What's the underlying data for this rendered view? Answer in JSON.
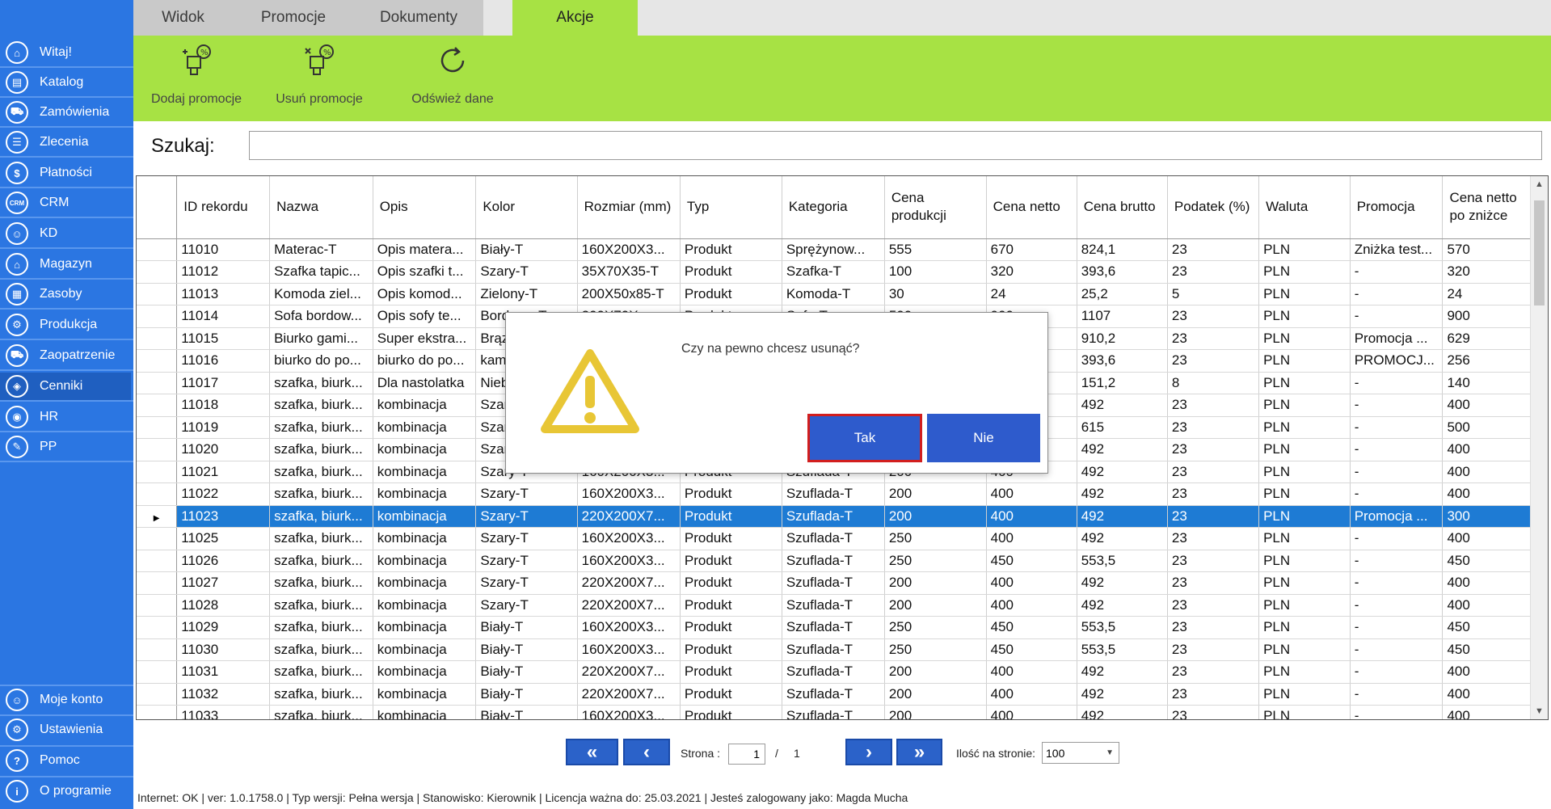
{
  "sidebar": {
    "top_items": [
      {
        "label": "Witaj!",
        "icon": "home-icon",
        "glyph": "⌂"
      },
      {
        "label": "Katalog",
        "icon": "book-icon",
        "glyph": "▤"
      },
      {
        "label": "Zamówienia",
        "icon": "cart-icon",
        "glyph": "⛟"
      },
      {
        "label": "Zlecenia",
        "icon": "list-icon",
        "glyph": "☰"
      },
      {
        "label": "Płatności",
        "icon": "dollar-icon",
        "glyph": "$"
      },
      {
        "label": "CRM",
        "icon": "crm-icon",
        "glyph": "CRM"
      },
      {
        "label": "KD",
        "icon": "user-icon",
        "glyph": "☺"
      },
      {
        "label": "Magazyn",
        "icon": "warehouse-icon",
        "glyph": "⌂"
      },
      {
        "label": "Zasoby",
        "icon": "resources-icon",
        "glyph": "▦"
      },
      {
        "label": "Produkcja",
        "icon": "production-icon",
        "glyph": "⚙"
      },
      {
        "label": "Zaopatrzenie",
        "icon": "supply-icon",
        "glyph": "⛟"
      },
      {
        "label": "Cenniki",
        "icon": "tag-icon",
        "glyph": "◈"
      },
      {
        "label": "HR",
        "icon": "hr-icon",
        "glyph": "◉"
      },
      {
        "label": "PP",
        "icon": "pp-icon",
        "glyph": "✎"
      }
    ],
    "active_index": 11,
    "bottom_items": [
      {
        "label": "Moje konto",
        "icon": "account-icon",
        "glyph": "☺"
      },
      {
        "label": "Ustawienia",
        "icon": "settings-icon",
        "glyph": "⚙"
      },
      {
        "label": "Pomoc",
        "icon": "help-icon",
        "glyph": "?"
      },
      {
        "label": "O programie",
        "icon": "info-icon",
        "glyph": "i"
      }
    ]
  },
  "tabs": [
    "Widok",
    "Promocje",
    "Dokumenty",
    "Akcje"
  ],
  "active_tab": "Akcje",
  "toolbar": {
    "add": "Dodaj promocje",
    "remove": "Usuń promocje",
    "refresh": "Odśwież dane"
  },
  "search": {
    "label": "Szukaj:",
    "value": "",
    "placeholder": ""
  },
  "table": {
    "columns": [
      "ID rekordu",
      "Nazwa",
      "Opis",
      "Kolor",
      "Rozmiar (mm)",
      "Typ",
      "Kategoria",
      "Cena produkcji",
      "Cena netto",
      "Cena brutto",
      "Podatek (%)",
      "Waluta",
      "Promocja",
      "Cena netto po zniżce"
    ],
    "selected_row": 12,
    "rows": [
      [
        "11010",
        "Materac-T",
        "Opis matera...",
        "Biały-T",
        "160X200X3...",
        "Produkt",
        "Sprężynow...",
        "555",
        "670",
        "824,1",
        "23",
        "PLN",
        "Zniżka test...",
        "570"
      ],
      [
        "11012",
        "Szafka tapic...",
        "Opis szafki t...",
        "Szary-T",
        "35X70X35-T",
        "Produkt",
        "Szafka-T",
        "100",
        "320",
        "393,6",
        "23",
        "PLN",
        "-",
        "320"
      ],
      [
        "11013",
        "Komoda ziel...",
        "Opis komod...",
        "Zielony-T",
        "200X50x85-T",
        "Produkt",
        "Komoda-T",
        "30",
        "24",
        "25,2",
        "5",
        "PLN",
        "-",
        "24"
      ],
      [
        "11014",
        "Sofa bordow...",
        "Opis sofy te...",
        "Bordowy-T",
        "200X70X...",
        "Produkt",
        "Sofa-T",
        "500",
        "900",
        "1107",
        "23",
        "PLN",
        "-",
        "900"
      ],
      [
        "11015",
        "Biurko gami...",
        "Super ekstra...",
        "Brązowy-T",
        "...",
        "Produkt",
        "...",
        "...",
        "...",
        "910,2",
        "23",
        "PLN",
        "Promocja ...",
        "629"
      ],
      [
        "11016",
        "biurko do po...",
        "biurko do po...",
        "kamień",
        "...",
        "Produkt",
        "...",
        "...",
        "...",
        "393,6",
        "23",
        "PLN",
        "PROMOCJ...",
        "256"
      ],
      [
        "11017",
        "szafka, biurk...",
        "Dla nastolatka",
        "Niebieski",
        "...",
        "Produkt",
        "...",
        "...",
        "...",
        "151,2",
        "8",
        "PLN",
        "-",
        "140"
      ],
      [
        "11018",
        "szafka, biurk...",
        "kombinacja",
        "Szary-T",
        "...",
        "Produkt",
        "...",
        "...",
        "...",
        "492",
        "23",
        "PLN",
        "-",
        "400"
      ],
      [
        "11019",
        "szafka, biurk...",
        "kombinacja",
        "Szary-T",
        "...",
        "Produkt",
        "...",
        "...",
        "...",
        "615",
        "23",
        "PLN",
        "-",
        "500"
      ],
      [
        "11020",
        "szafka, biurk...",
        "kombinacja",
        "Szary-T",
        "...",
        "Produkt",
        "...",
        "...",
        "...",
        "492",
        "23",
        "PLN",
        "-",
        "400"
      ],
      [
        "11021",
        "szafka, biurk...",
        "kombinacja",
        "Szary-T",
        "160X200X3...",
        "Produkt",
        "Szuflada-T",
        "200",
        "400",
        "492",
        "23",
        "PLN",
        "-",
        "400"
      ],
      [
        "11022",
        "szafka, biurk...",
        "kombinacja",
        "Szary-T",
        "160X200X3...",
        "Produkt",
        "Szuflada-T",
        "200",
        "400",
        "492",
        "23",
        "PLN",
        "-",
        "400"
      ],
      [
        "11023",
        "szafka, biurk...",
        "kombinacja",
        "Szary-T",
        "220X200X7...",
        "Produkt",
        "Szuflada-T",
        "200",
        "400",
        "492",
        "23",
        "PLN",
        "Promocja ...",
        "300"
      ],
      [
        "11025",
        "szafka, biurk...",
        "kombinacja",
        "Szary-T",
        "160X200X3...",
        "Produkt",
        "Szuflada-T",
        "250",
        "400",
        "492",
        "23",
        "PLN",
        "-",
        "400"
      ],
      [
        "11026",
        "szafka, biurk...",
        "kombinacja",
        "Szary-T",
        "160X200X3...",
        "Produkt",
        "Szuflada-T",
        "250",
        "450",
        "553,5",
        "23",
        "PLN",
        "-",
        "450"
      ],
      [
        "11027",
        "szafka, biurk...",
        "kombinacja",
        "Szary-T",
        "220X200X7...",
        "Produkt",
        "Szuflada-T",
        "200",
        "400",
        "492",
        "23",
        "PLN",
        "-",
        "400"
      ],
      [
        "11028",
        "szafka, biurk...",
        "kombinacja",
        "Szary-T",
        "220X200X7...",
        "Produkt",
        "Szuflada-T",
        "200",
        "400",
        "492",
        "23",
        "PLN",
        "-",
        "400"
      ],
      [
        "11029",
        "szafka, biurk...",
        "kombinacja",
        "Biały-T",
        "160X200X3...",
        "Produkt",
        "Szuflada-T",
        "250",
        "450",
        "553,5",
        "23",
        "PLN",
        "-",
        "450"
      ],
      [
        "11030",
        "szafka, biurk...",
        "kombinacja",
        "Biały-T",
        "160X200X3...",
        "Produkt",
        "Szuflada-T",
        "250",
        "450",
        "553,5",
        "23",
        "PLN",
        "-",
        "450"
      ],
      [
        "11031",
        "szafka, biurk...",
        "kombinacja",
        "Biały-T",
        "220X200X7...",
        "Produkt",
        "Szuflada-T",
        "200",
        "400",
        "492",
        "23",
        "PLN",
        "-",
        "400"
      ],
      [
        "11032",
        "szafka, biurk...",
        "kombinacja",
        "Biały-T",
        "220X200X7...",
        "Produkt",
        "Szuflada-T",
        "200",
        "400",
        "492",
        "23",
        "PLN",
        "-",
        "400"
      ],
      [
        "11033",
        "szafka, biurk...",
        "kombinacja",
        "Biały-T",
        "160X200X3...",
        "Produkt",
        "Szuflada-T",
        "200",
        "400",
        "492",
        "23",
        "PLN",
        "-",
        "400"
      ]
    ]
  },
  "pager": {
    "page_label": "Strona :",
    "current_page": "1",
    "separator": "/",
    "total_pages": "1",
    "per_page_label": "Ilość na stronie:",
    "per_page_value": "100"
  },
  "status_bar": "Internet: OK  |   ver: 1.0.1758.0   |   Typ wersji: Pełna wersja   |   Stanowisko: Kierownik   |   Licencja ważna do: 25.03.2021   |   Jesteś zalogowany jako: Magda Mucha",
  "dialog": {
    "message": "Czy na pewno chcesz usunąć?",
    "yes": "Tak",
    "no": "Nie",
    "icon": "warning-icon"
  },
  "colors": {
    "sidebar": "#2b76e2",
    "ribbon": "#a7e244",
    "selection": "#1e7bd4",
    "dialog_button": "#2e5bcc",
    "focus_border": "#d21e1e",
    "warning": "#e8c635"
  }
}
